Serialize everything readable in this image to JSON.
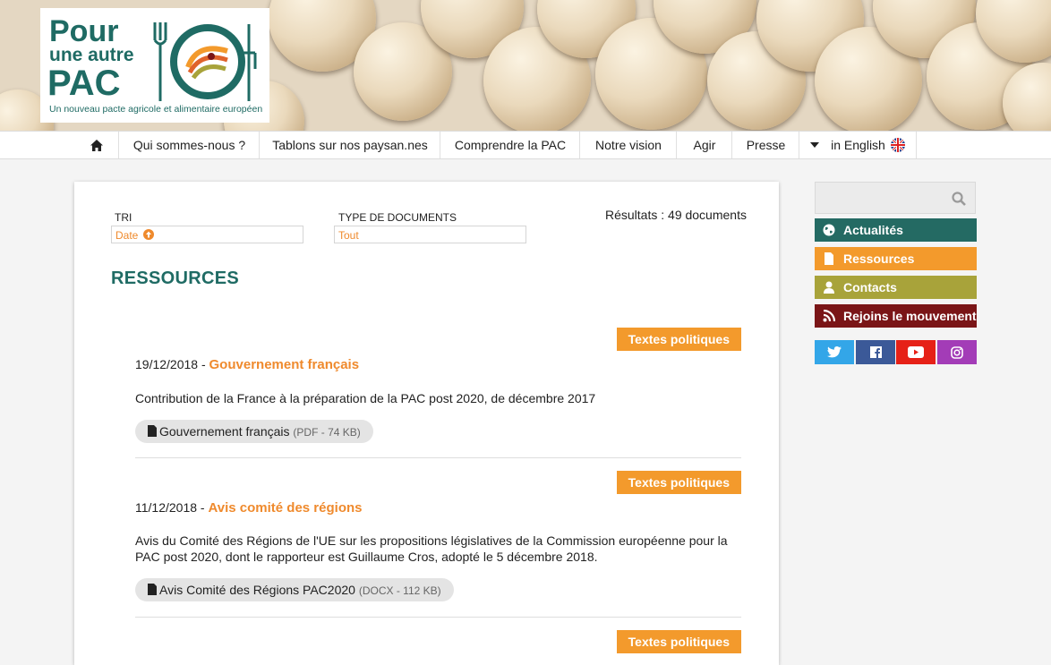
{
  "logo": {
    "line1": "Pour",
    "line2": "une autre",
    "line3": "PAC",
    "tagline": "Un nouveau pacte agricole et alimentaire européen"
  },
  "nav": {
    "items": [
      {
        "label": "Qui sommes-nous ?"
      },
      {
        "label": "Tablons sur nos paysan.nes"
      },
      {
        "label": "Comprendre la PAC"
      },
      {
        "label": "Notre vision"
      },
      {
        "label": "Agir"
      },
      {
        "label": "Presse"
      }
    ],
    "language": "in English"
  },
  "filters": {
    "sort_label": "TRI",
    "sort_value": "Date",
    "type_label": "TYPE DE DOCUMENTS",
    "type_value": "Tout",
    "results": "Résultats : 49 documents"
  },
  "page_title": "RESSOURCES",
  "entries": [
    {
      "category": "Textes politiques",
      "date": "19/12/2018 - ",
      "title": "Gouvernement français",
      "description": "Contribution de la France à la préparation de la PAC post 2020, de décembre 2017",
      "file_name": "Gouvernement français",
      "file_meta": "(PDF - 74 KB)"
    },
    {
      "category": "Textes politiques",
      "date": "11/12/2018 - ",
      "title": "Avis comité des régions",
      "description": "Avis du Comité des Régions de l'UE sur les propositions législatives de la Commission européenne pour la PAC post 2020, dont le rapporteur est Guillaume Cros, adopté le 5 décembre 2018.",
      "file_name": "Avis Comité des Régions PAC2020",
      "file_meta": "(DOCX - 112 KB)"
    },
    {
      "category": "Textes politiques"
    }
  ],
  "sidebar": {
    "buttons": [
      {
        "label": "Actualités",
        "color": "#246a63"
      },
      {
        "label": "Ressources",
        "color": "#f39a2c"
      },
      {
        "label": "Contacts",
        "color": "#a8a33a"
      },
      {
        "label": "Rejoins le mouvement",
        "color": "#7a1517"
      }
    ],
    "social": [
      {
        "icon": "twitter-icon",
        "color": "#33a6e8"
      },
      {
        "icon": "facebook-icon",
        "color": "#3b5998"
      },
      {
        "icon": "youtube-icon",
        "color": "#e62117"
      },
      {
        "icon": "instagram-icon",
        "color": "#a33cb7"
      }
    ]
  },
  "colors": {
    "brand_teal": "#1f6b64",
    "accent_orange": "#ef8a2d"
  }
}
